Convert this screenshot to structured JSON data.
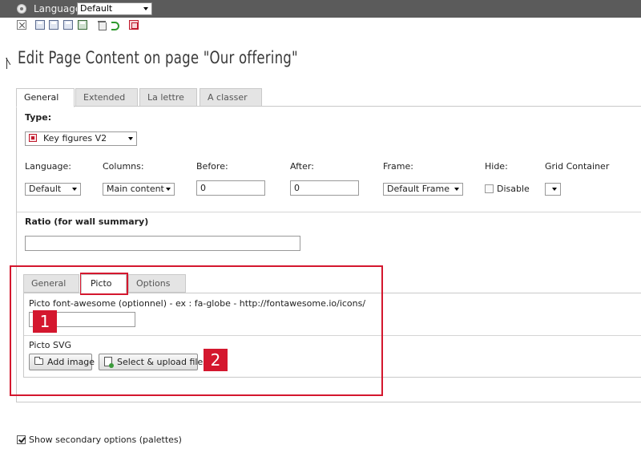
{
  "topbar": {
    "language_label": "Language:",
    "language_value": "Default",
    "icons": [
      "globe-icon"
    ]
  },
  "toolbar": {
    "icons": [
      "close-icon",
      "save-icon",
      "save-view-icon",
      "save-new-icon",
      "save-close-icon",
      "delete-icon",
      "undo-icon",
      "history-icon"
    ]
  },
  "page": {
    "title": "Edit Page Content on page \"Our offering\""
  },
  "main_tabs": [
    {
      "label": "General",
      "active": true
    },
    {
      "label": "Extended",
      "active": false
    },
    {
      "label": "La lettre",
      "active": false
    },
    {
      "label": "A classer",
      "active": false
    }
  ],
  "form": {
    "type_label": "Type:",
    "type_value": "Key figures V2",
    "language_label": "Language:",
    "language_value": "Default",
    "columns_label": "Columns:",
    "columns_value": "Main content",
    "before_label": "Before:",
    "before_value": "0",
    "after_label": "After:",
    "after_value": "0",
    "frame_label": "Frame:",
    "frame_value": "Default Frame",
    "hide_label": "Hide:",
    "disable_label": "Disable",
    "disable_checked": false,
    "grid_label": "Grid Container",
    "grid_value": "",
    "ratio_label": "Ratio (for wall summary)",
    "ratio_value": ""
  },
  "inner_tabs": [
    {
      "label": "General",
      "active": false
    },
    {
      "label": "Picto",
      "active": true
    },
    {
      "label": "Options",
      "active": false
    }
  ],
  "picto": {
    "fa_label": "Picto font-awesome (optionnel) - ex : fa-globe - http://fontawesome.io/icons/",
    "fa_value": "",
    "svg_label": "Picto SVG",
    "add_image_label": "Add image",
    "upload_label": "Select & upload files"
  },
  "annotations": {
    "badge_1": "1",
    "badge_2": "2",
    "color": "#d4172e"
  },
  "footer": {
    "secondary_label": "Show secondary options (palettes)",
    "secondary_checked": true
  },
  "colors": {
    "topbar": "#5b5b5b",
    "accent_red": "#d4172e",
    "tab_inactive": "#e4e4e4",
    "border": "#c9c9c9"
  }
}
